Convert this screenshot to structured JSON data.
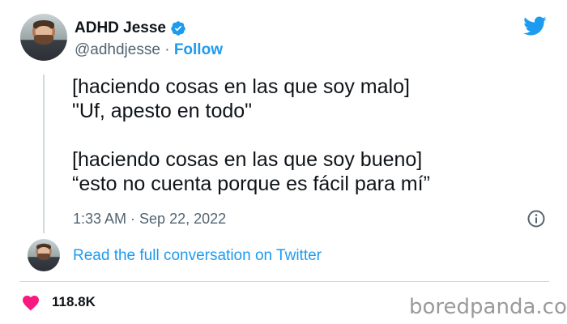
{
  "author": {
    "display_name": "ADHD Jesse",
    "handle": "@adhdjesse",
    "separator": "·",
    "follow_label": "Follow"
  },
  "icons": {
    "verified": "verified-badge-icon",
    "twitter": "twitter-bird-icon",
    "info": "info-icon",
    "like": "heart-icon"
  },
  "colors": {
    "accent": "#1d9bf0",
    "text": "#0f1419",
    "muted": "#536471",
    "like": "#f91880",
    "watermark": "#9a9a9a"
  },
  "tweet": {
    "text": "[haciendo cosas en las que soy malo]\n\"Uf, apesto en todo\"\n\n[haciendo cosas en las que soy bueno]\n“esto no cuenta porque es fácil para mí”",
    "timestamp": "1:33 AM · Sep 22, 2022"
  },
  "conversation": {
    "link_label": "Read the full conversation on Twitter"
  },
  "engagement": {
    "likes": "118.8K"
  },
  "watermark": "boredpanda.com"
}
